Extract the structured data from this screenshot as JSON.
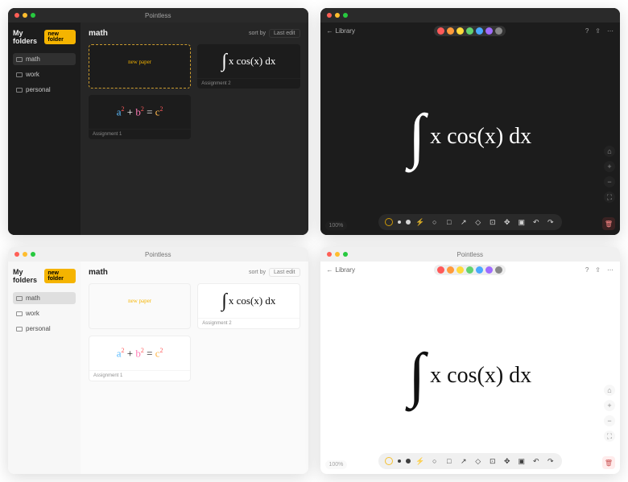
{
  "app_name": "Pointless",
  "sidebar": {
    "title": "My folders",
    "new_btn": "new folder",
    "items": [
      {
        "label": "math",
        "selected": true
      },
      {
        "label": "work",
        "selected": false
      },
      {
        "label": "personal",
        "selected": false
      }
    ]
  },
  "main": {
    "title": "math",
    "sort_label": "sort by",
    "sort_value": "Last edit",
    "new_paper_label": "new paper",
    "cards": [
      {
        "caption": "Assignment 2",
        "content": "integral"
      },
      {
        "caption": "Assignment 1",
        "content": "pythagoras"
      }
    ]
  },
  "editor": {
    "back_label": "Library",
    "colors": [
      "#ff5a5a",
      "#ff9a3c",
      "#ffd93c",
      "#62d26f",
      "#4aa8ff",
      "#a06bff",
      "#888888"
    ],
    "zoom": "100%",
    "canvas_formula": "∫ x cos(x) dx"
  }
}
